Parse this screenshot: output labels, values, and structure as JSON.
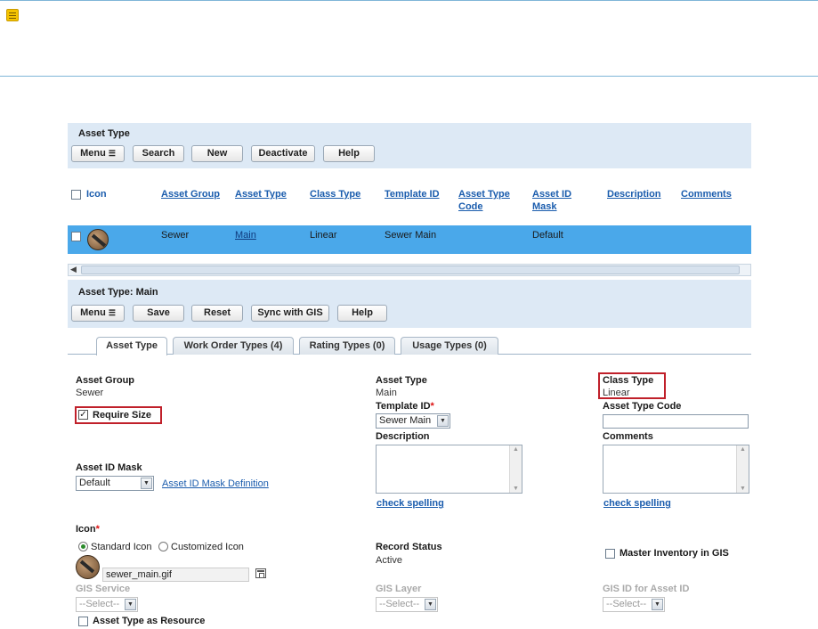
{
  "asset_type_panel": {
    "title": "Asset Type",
    "buttons": {
      "menu": "Menu",
      "search": "Search",
      "new": "New",
      "deactivate": "Deactivate",
      "help": "Help"
    }
  },
  "grid": {
    "columns": [
      "Icon",
      "Asset Group",
      "Asset Type",
      "Class Type",
      "Template ID",
      "Asset Type Code",
      "Asset ID Mask",
      "Description",
      "Comments"
    ],
    "row": {
      "asset_group": "Sewer",
      "asset_type": "Main",
      "class_type": "Linear",
      "template_id": "Sewer Main",
      "asset_type_code": "",
      "asset_id_mask": "Default",
      "description": "",
      "comments": ""
    }
  },
  "detail_panel": {
    "title": "Asset Type: Main",
    "buttons": {
      "menu": "Menu",
      "save": "Save",
      "reset": "Reset",
      "sync": "Sync with GIS",
      "help": "Help"
    }
  },
  "tabs": [
    "Asset Type",
    "Work Order Types (4)",
    "Rating Types (0)",
    "Usage Types (0)"
  ],
  "form": {
    "asset_group_label": "Asset Group",
    "asset_group_value": "Sewer",
    "require_size_label": "Require Size",
    "asset_id_mask_label": "Asset ID Mask",
    "asset_id_mask_value": "Default",
    "asset_id_mask_link": "Asset ID Mask Definition",
    "asset_type_label": "Asset Type",
    "asset_type_value": "Main",
    "template_id_label": "Template ID",
    "template_id_value": "Sewer Main",
    "description_label": "Description",
    "check_spelling": "check spelling",
    "class_type_label": "Class Type",
    "class_type_value": "Linear",
    "asset_type_code_label": "Asset Type Code",
    "comments_label": "Comments",
    "icon_label": "Icon",
    "standard_icon": "Standard Icon",
    "customized_icon": "Customized Icon",
    "icon_file": "sewer_main.gif",
    "record_status_label": "Record Status",
    "record_status_value": "Active",
    "master_inventory_label": "Master Inventory in GIS",
    "gis_service_label": "GIS Service",
    "gis_layer_label": "GIS Layer",
    "gis_id_label": "GIS ID for Asset ID",
    "select_placeholder": "--Select--",
    "asset_type_resource_label": "Asset Type as Resource"
  },
  "colors": {
    "panel_bg": "#dde9f5",
    "selected_row": "#4aa8ea",
    "highlight_border": "#c0202a",
    "link": "#1a5cad"
  }
}
